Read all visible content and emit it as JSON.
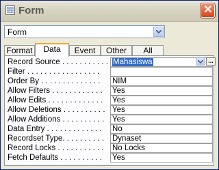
{
  "window": {
    "title": "Form"
  },
  "selector": {
    "value": "Form"
  },
  "tabs": [
    "Format",
    "Data",
    "Event",
    "Other",
    "All"
  ],
  "active_tab": "Data",
  "properties": [
    {
      "label": "Record Source . . . . . . . . . . .",
      "value": "Mahasiswa",
      "selected": true
    },
    {
      "label": "Filter . . . . . . . . . . . . . . . . .",
      "value": ""
    },
    {
      "label": "Order By . . . . . . . . . . . . . .",
      "value": "NIM"
    },
    {
      "label": "Allow Filters . . . . . . . . . . . .",
      "value": "Yes"
    },
    {
      "label": "Allow Edits . . . . . . . . . . . . .",
      "value": "Yes"
    },
    {
      "label": "Allow Deletions . . . . . . . . . .",
      "value": "Yes"
    },
    {
      "label": "Allow Additions . . . . . . . . . .",
      "value": "Yes"
    },
    {
      "label": "Data Entry . . . . . . . . . . . . .",
      "value": "No"
    },
    {
      "label": "Recordset Type. . . . . . . . . .",
      "value": "Dynaset"
    },
    {
      "label": "Record Locks . . . . . . . . . . .",
      "value": "No Locks"
    },
    {
      "label": "Fetch Defaults . . . . . . . . . .",
      "value": "Yes"
    }
  ],
  "builder_label": "..."
}
